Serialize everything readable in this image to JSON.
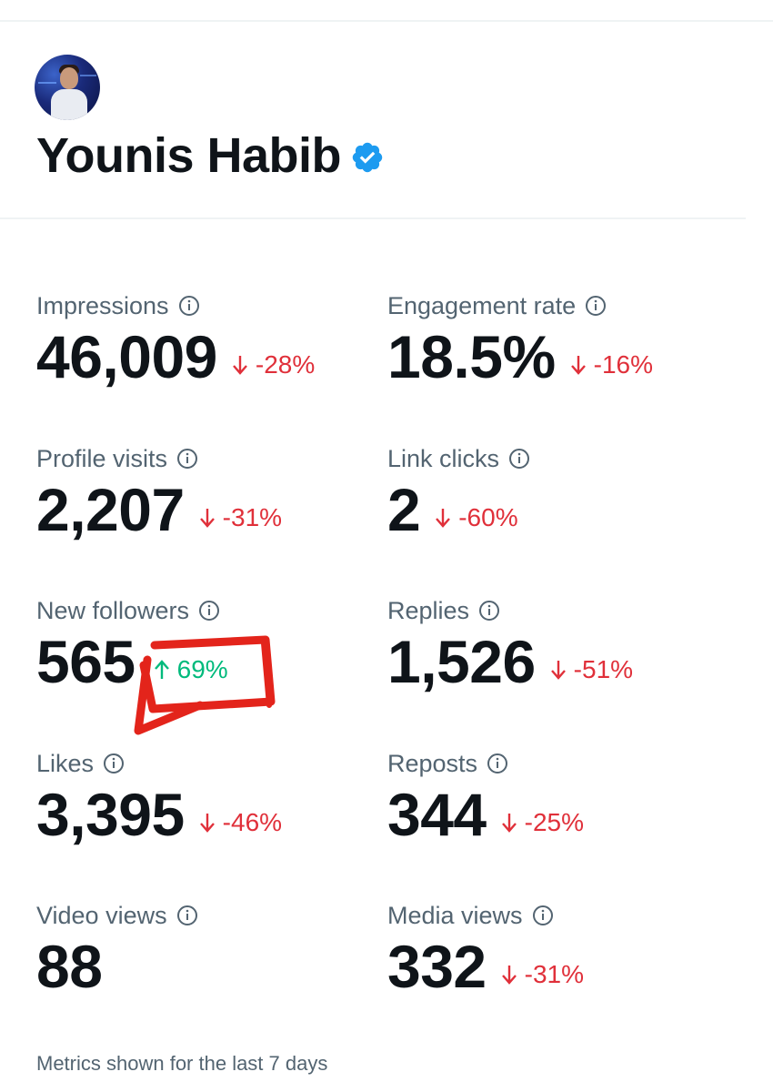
{
  "profile": {
    "name": "Younis Habib",
    "verified_icon": "verified-badge-icon"
  },
  "colors": {
    "text_primary": "#0f1419",
    "text_secondary": "#536471",
    "negative": "#e0303a",
    "positive": "#00ba7c",
    "verified": "#1d9bf0",
    "annotation": "#e3241b"
  },
  "metrics": [
    {
      "label": "Impressions",
      "value": "46,009",
      "change": "-28%",
      "direction": "down"
    },
    {
      "label": "Engagement rate",
      "value": "18.5%",
      "change": "-16%",
      "direction": "down"
    },
    {
      "label": "Profile visits",
      "value": "2,207",
      "change": "-31%",
      "direction": "down"
    },
    {
      "label": "Link clicks",
      "value": "2",
      "change": "-60%",
      "direction": "down"
    },
    {
      "label": "New followers",
      "value": "565",
      "change": "69%",
      "direction": "up"
    },
    {
      "label": "Replies",
      "value": "1,526",
      "change": "-51%",
      "direction": "down"
    },
    {
      "label": "Likes",
      "value": "3,395",
      "change": "-46%",
      "direction": "down"
    },
    {
      "label": "Reposts",
      "value": "344",
      "change": "-25%",
      "direction": "down"
    },
    {
      "label": "Video views",
      "value": "88",
      "change": "",
      "direction": "none"
    },
    {
      "label": "Media views",
      "value": "332",
      "change": "-31%",
      "direction": "down"
    }
  ],
  "footer": {
    "note": "Metrics shown for the last 7 days"
  }
}
